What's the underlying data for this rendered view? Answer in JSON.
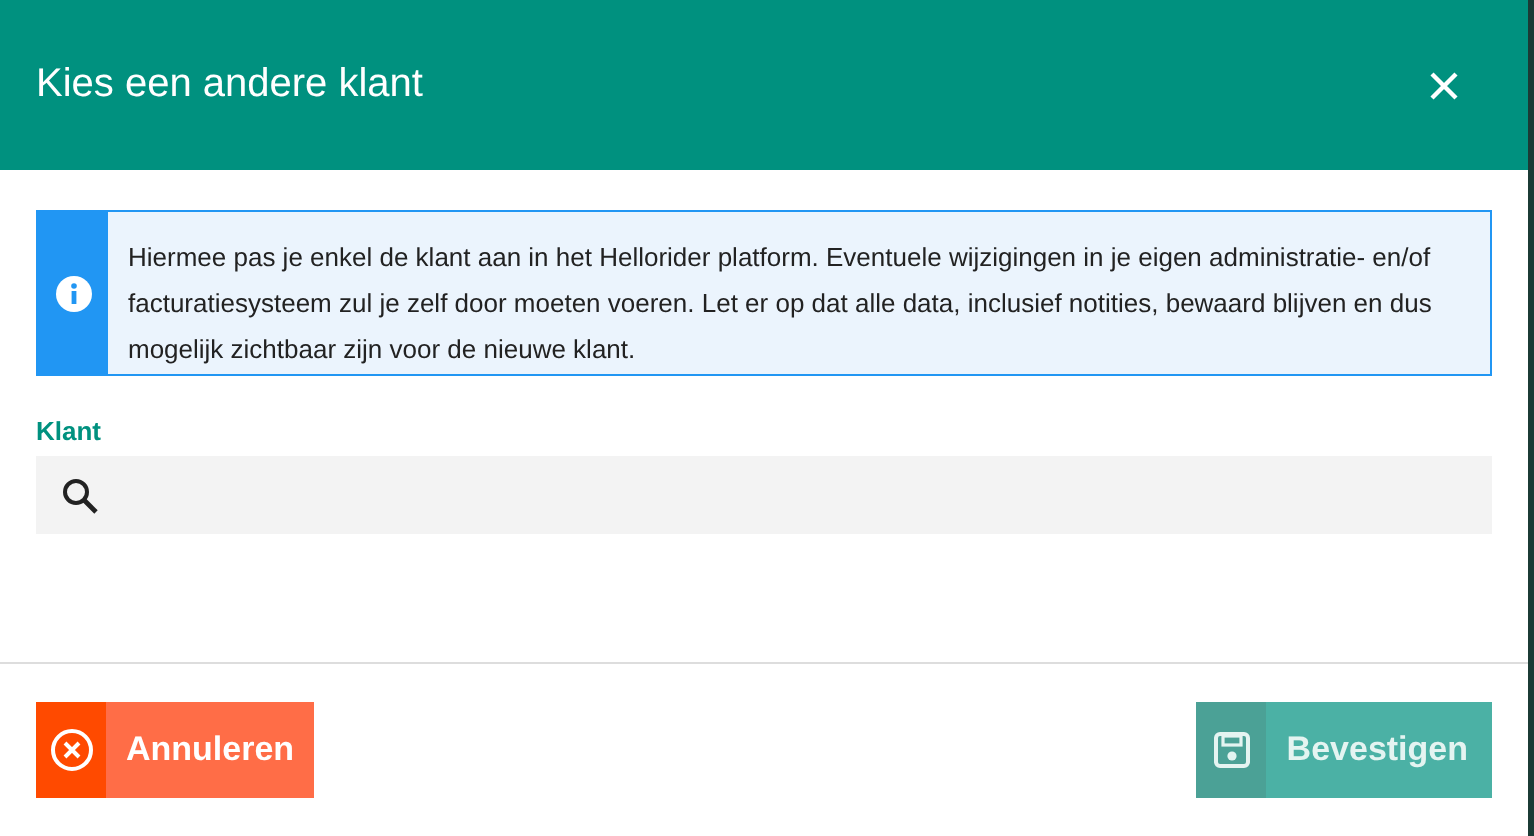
{
  "dialog": {
    "title": "Kies een andere klant"
  },
  "alert": {
    "text": "Hiermee pas je enkel de klant aan in het Hellorider platform. Eventuele wijzigingen in je eigen administratie- en/of facturatiesysteem zul je zelf door moeten voeren. Let er op dat alle data, inclusief notities, bewaard blijven en dus mogelijk zichtbaar zijn voor de nieuwe klant."
  },
  "field": {
    "label": "Klant"
  },
  "buttons": [
    {
      "kind": "cancel",
      "label": "Annuleren",
      "disabled": false
    },
    {
      "kind": "confirm",
      "label": "Bevestigen",
      "disabled": true
    }
  ]
}
